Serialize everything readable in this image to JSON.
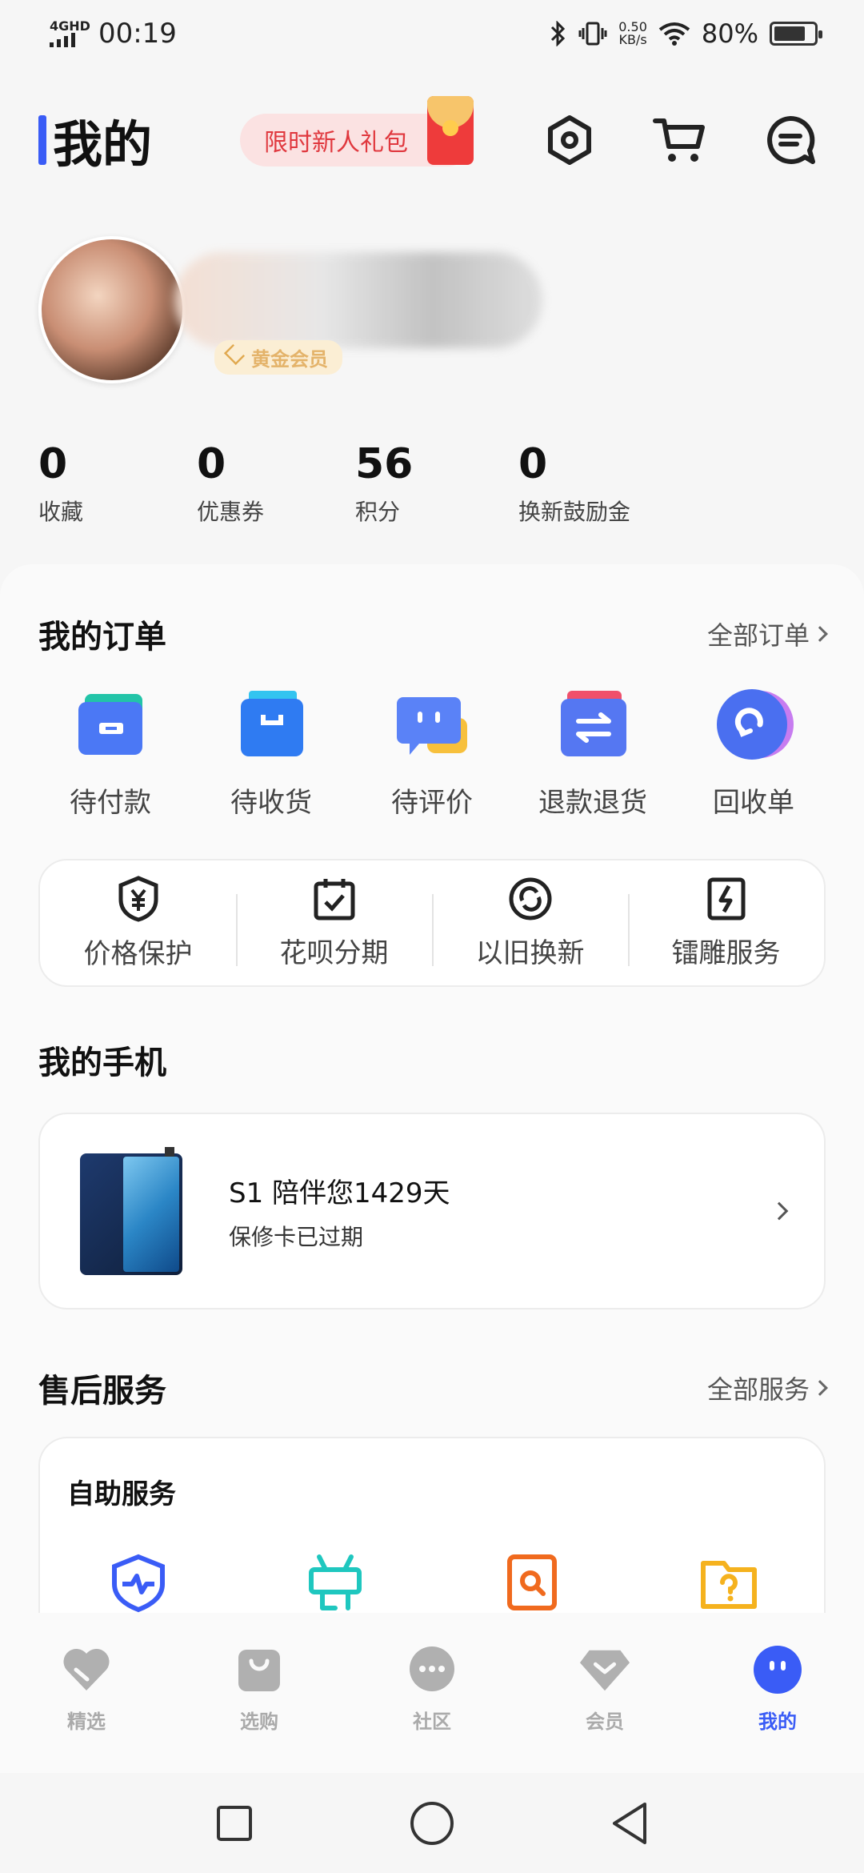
{
  "status": {
    "network": "4GHD",
    "time": "00:19",
    "speed_value": "0.50",
    "speed_unit": "KB/s",
    "battery": "80%",
    "battery_level": 0.8
  },
  "header": {
    "title": "我的",
    "promo_label": "限时新人礼包",
    "icons": [
      "settings-icon",
      "cart-icon",
      "message-icon"
    ]
  },
  "profile": {
    "member_level": "黄金会员"
  },
  "stats": [
    {
      "value": "0",
      "label": "收藏"
    },
    {
      "value": "0",
      "label": "优惠券"
    },
    {
      "value": "56",
      "label": "积分"
    },
    {
      "value": "0",
      "label": "换新鼓励金"
    }
  ],
  "orders": {
    "title": "我的订单",
    "more": "全部订单",
    "items": [
      {
        "label": "待付款",
        "icon": "wallet-icon"
      },
      {
        "label": "待收货",
        "icon": "bag-icon"
      },
      {
        "label": "待评价",
        "icon": "comment-icon"
      },
      {
        "label": "退款退货",
        "icon": "refund-icon"
      },
      {
        "label": "回收单",
        "icon": "recycle-icon"
      }
    ],
    "services": [
      {
        "label": "价格保护",
        "icon": "price-shield-icon"
      },
      {
        "label": "花呗分期",
        "icon": "calendar-check-icon"
      },
      {
        "label": "以旧换新",
        "icon": "trade-in-icon"
      },
      {
        "label": "镭雕服务",
        "icon": "engrave-icon"
      }
    ]
  },
  "phone": {
    "title": "我的手机",
    "name": "S1 陪伴您1429天",
    "status": "保修卡已过期"
  },
  "aftersales": {
    "title": "售后服务",
    "more": "全部服务",
    "selfhelp_title": "自助服务",
    "icons": [
      {
        "icon": "health-check-icon",
        "color": "#3a5cf6"
      },
      {
        "icon": "repair-icon",
        "color": "#1fc7bf"
      },
      {
        "icon": "search-doc-icon",
        "color": "#f06a1e"
      },
      {
        "icon": "help-folder-icon",
        "color": "#f5b21e"
      }
    ]
  },
  "tabs": [
    {
      "label": "精选",
      "icon": "heart-icon",
      "active": false
    },
    {
      "label": "选购",
      "icon": "shopping-bag-icon",
      "active": false
    },
    {
      "label": "社区",
      "icon": "chat-bubble-icon",
      "active": false
    },
    {
      "label": "会员",
      "icon": "diamond-icon",
      "active": false
    },
    {
      "label": "我的",
      "icon": "face-icon",
      "active": true
    }
  ],
  "colors": {
    "accent": "#3a5cf6",
    "promo_text": "#e0383e",
    "inactive_tab": "#aaaaaa"
  }
}
